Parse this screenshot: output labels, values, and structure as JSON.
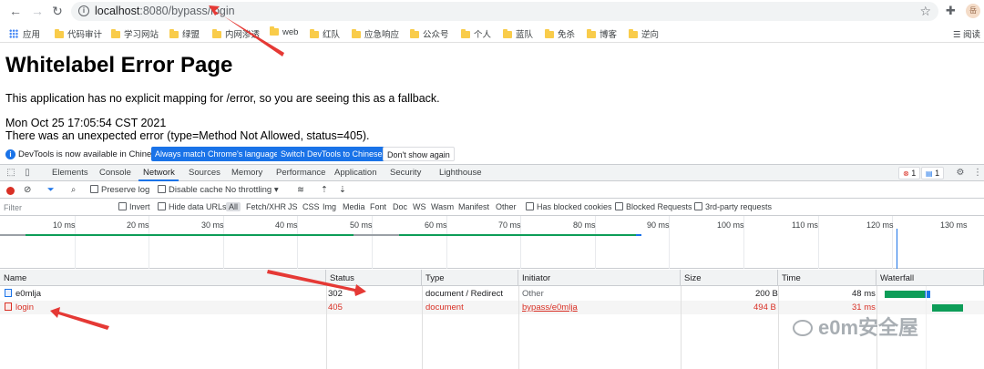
{
  "browser": {
    "url_host": "localhost",
    "url_rest": ":8080/bypass/login",
    "avatar_text": "岳",
    "bookmarks": [
      "应用",
      "代码审计",
      "学习网站",
      "绿盟",
      "内网渗透",
      "web",
      "红队",
      "应急响应",
      "公众号",
      "个人",
      "蓝队",
      "免杀",
      "博客",
      "逆向"
    ],
    "reading_list": "阅读"
  },
  "page": {
    "title": "Whitelabel Error Page",
    "line1": "This application has no explicit mapping for /error, so you are seeing this as a fallback.",
    "line2": "Mon Oct 25 17:05:54 CST 2021",
    "line3": "There was an unexpected error (type=Method Not Allowed, status=405)."
  },
  "infobar": {
    "message": "DevTools is now available in Chinese!",
    "btn_match": "Always match Chrome's language",
    "btn_switch": "Switch DevTools to Chinese",
    "btn_dismiss": "Don't show again"
  },
  "devtools": {
    "tabs": [
      "Elements",
      "Console",
      "Network",
      "Sources",
      "Memory",
      "Performance",
      "Application",
      "Security",
      "Lighthouse"
    ],
    "active_tab": "Network",
    "error_count": "1",
    "message_count": "1",
    "toolbar": {
      "preserve_log": "Preserve log",
      "disable_cache": "Disable cache",
      "throttling": "No throttling"
    },
    "filter": {
      "placeholder": "Filter",
      "invert": "Invert",
      "hide_data_urls": "Hide data URLs",
      "types": [
        "All",
        "Fetch/XHR",
        "JS",
        "CSS",
        "Img",
        "Media",
        "Font",
        "Doc",
        "WS",
        "Wasm",
        "Manifest",
        "Other"
      ],
      "has_blocked_cookies": "Has blocked cookies",
      "blocked_requests": "Blocked Requests",
      "third_party": "3rd-party requests"
    },
    "timeline_ticks": [
      "10 ms",
      "20 ms",
      "30 ms",
      "40 ms",
      "50 ms",
      "60 ms",
      "70 ms",
      "80 ms",
      "90 ms",
      "100 ms",
      "110 ms",
      "120 ms",
      "130 ms"
    ],
    "columns": [
      "Name",
      "Status",
      "Type",
      "Initiator",
      "Size",
      "Time",
      "Waterfall"
    ],
    "requests": [
      {
        "name": "e0mlja",
        "status": "302",
        "type": "document / Redirect",
        "initiator": "Other",
        "size": "200 B",
        "time": "48 ms",
        "error": false
      },
      {
        "name": "login",
        "status": "405",
        "type": "document",
        "initiator": "bypass/e0mlja",
        "size": "494 B",
        "time": "31 ms",
        "error": true
      }
    ],
    "colors": {
      "error": "#d93025",
      "accent": "#1a73e8",
      "waterfall_green": "#0d9d58"
    }
  },
  "watermark": "e0m安全屋"
}
